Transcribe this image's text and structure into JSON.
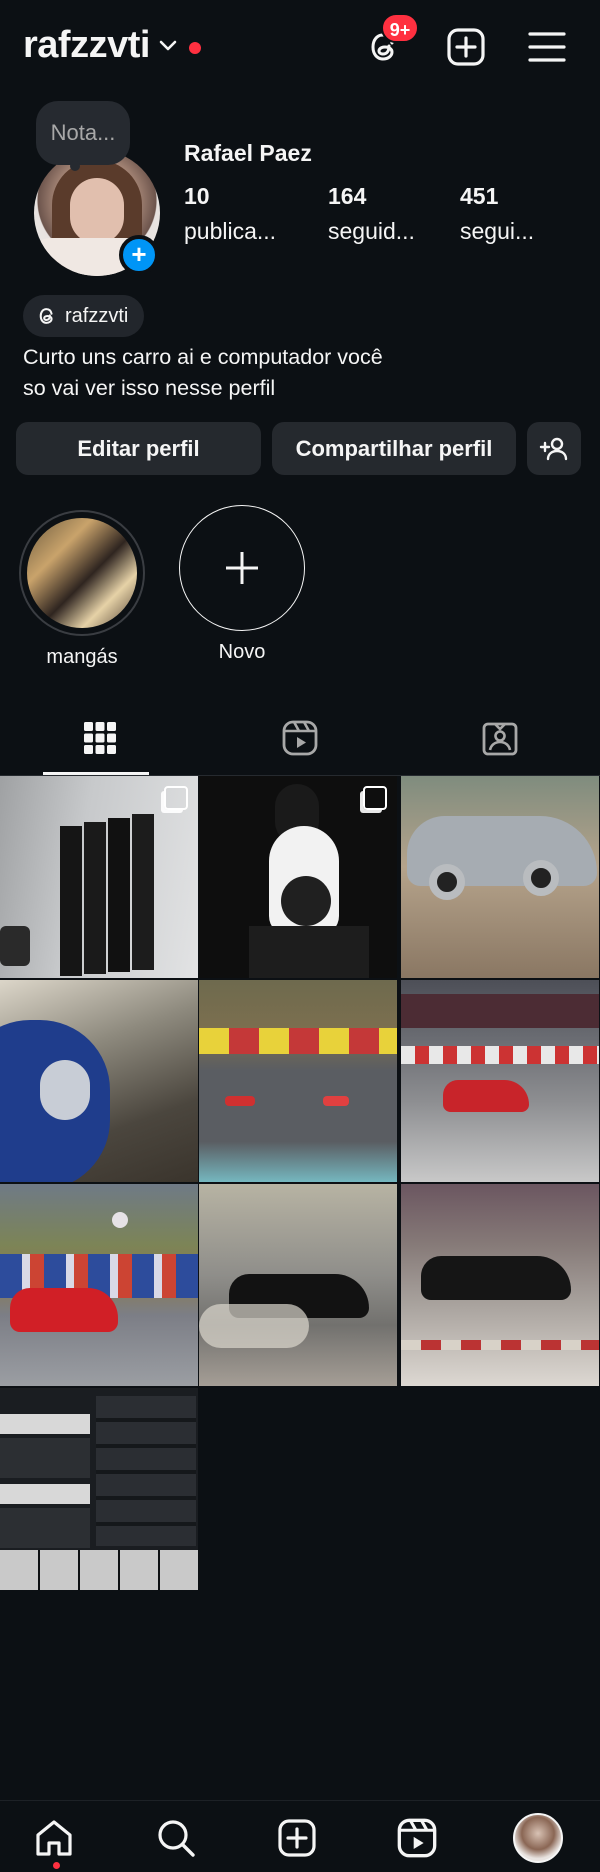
{
  "header": {
    "username": "rafzzvti",
    "threads_badge": "9+"
  },
  "profile": {
    "note_label": "Nota...",
    "full_name": "Rafael Paez",
    "stats": [
      {
        "value": "10",
        "label": "publica..."
      },
      {
        "value": "164",
        "label": "seguid..."
      },
      {
        "value": "451",
        "label": "segui..."
      }
    ],
    "threads_handle": "rafzzvti",
    "bio_line1": "Curto uns carro ai e computador você",
    "bio_line2": "so vai ver isso nesse perfil"
  },
  "buttons": {
    "edit": "Editar perfil",
    "share": "Compartilhar perfil"
  },
  "highlights": [
    {
      "label": "mangás"
    },
    {
      "label": "Novo"
    }
  ],
  "tabs": [
    "posts-grid",
    "reels",
    "tagged"
  ],
  "grid": {
    "posts": [
      {
        "desc": "book-boxes",
        "multi": true
      },
      {
        "desc": "cat",
        "multi": true
      },
      {
        "desc": "silver-hatchback"
      },
      {
        "desc": "blue-classic-car"
      },
      {
        "desc": "race-track-two-cars"
      },
      {
        "desc": "red-roadster-track"
      },
      {
        "desc": "red-roadster-mountains"
      },
      {
        "desc": "black-coupe-drift"
      },
      {
        "desc": "black-coupe-track"
      },
      {
        "desc": "game-leaderboard"
      }
    ]
  },
  "colors": {
    "background": "#0c1014",
    "accent": "#0095f6",
    "notification": "#ff3040",
    "button_bg": "#25292e"
  },
  "icons": [
    "chevron-down-icon",
    "threads-icon",
    "add-icon",
    "menu-icon",
    "add-person-icon",
    "grid-icon",
    "reels-icon",
    "tagged-icon",
    "home-icon",
    "search-icon",
    "create-icon",
    "reels-nav-icon"
  ]
}
